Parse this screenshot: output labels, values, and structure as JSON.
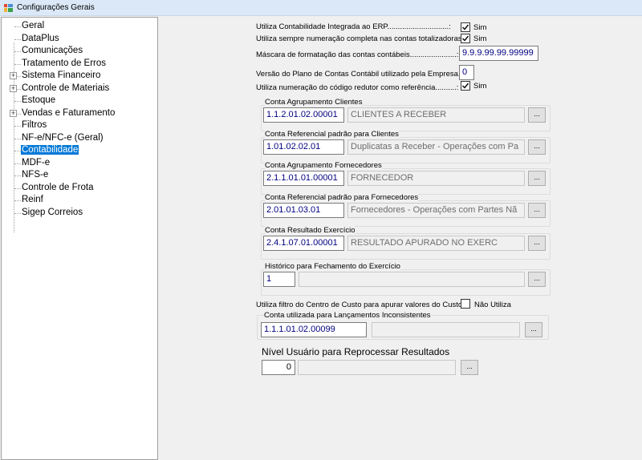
{
  "window": {
    "title": "Configurações Gerais"
  },
  "tree": {
    "items": [
      {
        "label": "Geral",
        "expandable": false
      },
      {
        "label": "DataPlus",
        "expandable": false
      },
      {
        "label": "Comunicações",
        "expandable": false
      },
      {
        "label": "Tratamento de Erros",
        "expandable": false
      },
      {
        "label": "Sistema Financeiro",
        "expandable": true
      },
      {
        "label": "Controle de Materiais",
        "expandable": true
      },
      {
        "label": "Estoque",
        "expandable": false
      },
      {
        "label": "Vendas e Faturamento",
        "expandable": true
      },
      {
        "label": "Filtros",
        "expandable": false
      },
      {
        "label": "NF-e/NFC-e (Geral)",
        "expandable": false
      },
      {
        "label": "Contabilidade",
        "expandable": false,
        "selected": true
      },
      {
        "label": "MDF-e",
        "expandable": false
      },
      {
        "label": "NFS-e",
        "expandable": false
      },
      {
        "label": "Controle de Frota",
        "expandable": false
      },
      {
        "label": "Reinf",
        "expandable": false
      },
      {
        "label": "Sigep Correios",
        "expandable": false
      }
    ]
  },
  "form": {
    "integrada_label": "Utiliza Contabilidade Integrada ao ERP.............................:",
    "integrada_value": "Sim",
    "numeracao_label": "Utiliza sempre numeração completa nas contas totalizadoras:",
    "numeracao_value": "Sim",
    "mascara_label": "Máscara de formatação das contas contábeis......................:",
    "mascara_value": "9.9.9.99.99.99999",
    "versao_label": "Versão do Plano de Contas Contábil utilizado pela Empresa.:",
    "versao_value": "0",
    "redutor_label": "Utiliza numeração do código redutor como referência..........:",
    "redutor_value": "Sim",
    "groups": [
      {
        "title": "Conta Agrupamento Clientes",
        "code": "1.1.2.01.02.00001",
        "desc": "CLIENTES A RECEBER"
      },
      {
        "title": "Conta Referencial padrão para Clientes",
        "code": "1.01.02.02.01",
        "desc": "Duplicatas a Receber - Operações com Pa"
      },
      {
        "title": "Conta Agrupamento Fornecedores",
        "code": "2.1.1.01.01.00001",
        "desc": "FORNECEDOR"
      },
      {
        "title": "Conta Referencial padrão para Fornecedores",
        "code": "2.01.01.03.01",
        "desc": "Fornecedores - Operações com Partes Nã"
      },
      {
        "title": "Conta Resultado Exercício",
        "code": "2.4.1.07.01.00001",
        "desc": "RESULTADO APURADO NO EXERC"
      },
      {
        "title": "Histórico para Fechamento do Exercício",
        "code": "1",
        "desc": ""
      }
    ],
    "browse_label": "...",
    "filtro_label": "Utiliza filtro do Centro de Custo para apurar valores do Custo:",
    "filtro_value": "Não Utiliza",
    "inconsistentes_title": "Conta utilizada para Lançamentos Inconsistentes",
    "inconsistentes_code": "1.1.1.01.02.00099",
    "inconsistentes_desc": "",
    "nivel_title": "Nível Usuário para Reprocessar Resultados",
    "nivel_value": "0",
    "nivel_desc": ""
  }
}
